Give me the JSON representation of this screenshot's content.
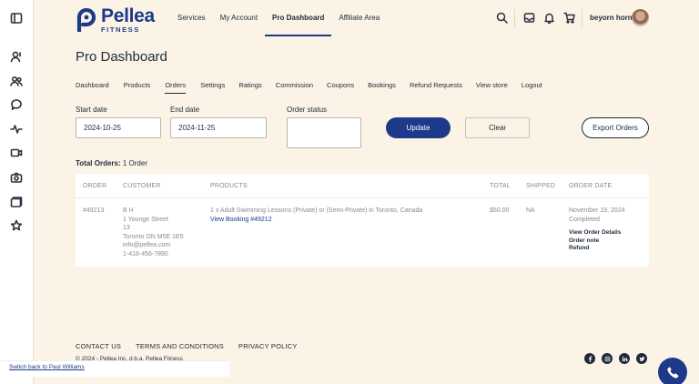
{
  "brand": {
    "name": "Pellea",
    "sub": "FITNESS",
    "color": "#1d3a8a"
  },
  "topnav": [
    {
      "label": "Services"
    },
    {
      "label": "My Account"
    },
    {
      "label": "Pro Dashboard",
      "active": true
    },
    {
      "label": "Affiliate Area"
    }
  ],
  "user": {
    "name": "beyorn horn"
  },
  "page": {
    "title": "Pro Dashboard"
  },
  "subnav": [
    {
      "label": "Dashboard"
    },
    {
      "label": "Products"
    },
    {
      "label": "Orders",
      "active": true
    },
    {
      "label": "Settings"
    },
    {
      "label": "Ratings"
    },
    {
      "label": "Commission"
    },
    {
      "label": "Coupons"
    },
    {
      "label": "Bookings"
    },
    {
      "label": "Refund Requests"
    },
    {
      "label": "View store"
    },
    {
      "label": "Logout"
    }
  ],
  "filters": {
    "start_label": "Start date",
    "start_value": "2024-10-25",
    "end_label": "End date",
    "end_value": "2024-11-25",
    "status_label": "Order status",
    "update_label": "Update",
    "clear_label": "Clear",
    "export_label": "Export Orders"
  },
  "totals": {
    "label": "Total Orders:",
    "value": "1 Order"
  },
  "table": {
    "headers": {
      "order": "ORDER",
      "customer": "CUSTOMER",
      "products": "PRODUCTS",
      "total": "TOTAL",
      "shipped": "SHIPPED",
      "date": "ORDER DATE"
    },
    "row": {
      "order": "#49213",
      "customer": [
        "B H",
        "1 Younge Street",
        "13",
        "Toronto ON M5E 1E5",
        "info@pellea.com",
        "1-416-456-7890"
      ],
      "product": "1 x Adult Swimming Lessons (Private) or (Semi-Private) in Toronto, Canada",
      "booking_link": "View Booking #49212",
      "total": "$50.00",
      "shipped": "NA",
      "date": "November 19, 2024",
      "status": "Completed",
      "actions": [
        "View Order Details",
        "Order note",
        "Refund"
      ]
    }
  },
  "footer": {
    "links": [
      "CONTACT US",
      "TERMS AND CONDITIONS",
      "PRIVACY POLICY"
    ],
    "copyright": "© 2024 - Pellea Inc. d.b.a. Pellea Fitness",
    "socials": [
      "facebook-icon",
      "instagram-icon",
      "linkedin-icon",
      "twitter-icon"
    ]
  },
  "switch_back": "Switch back to Paul Williams"
}
